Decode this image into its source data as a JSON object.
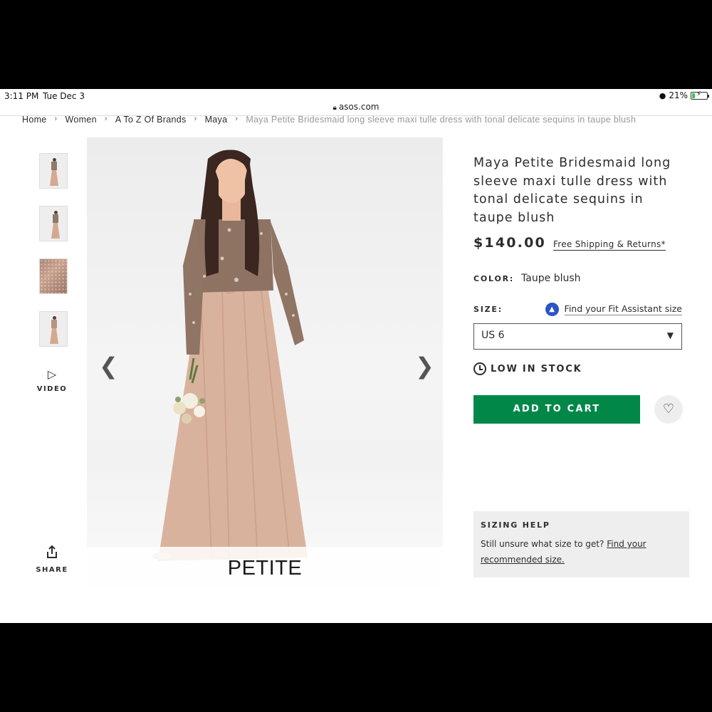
{
  "status_bar": {
    "time": "3:11 PM",
    "date": "Tue Dec 3",
    "battery": "21%",
    "battery_level": 0.21
  },
  "browser": {
    "url": "asos.com"
  },
  "breadcrumb": [
    {
      "label": "Home"
    },
    {
      "label": "Women"
    },
    {
      "label": "A To Z Of Brands"
    },
    {
      "label": "Maya"
    },
    {
      "label": "Maya Petite Bridesmaid long sleeve maxi tulle dress with tonal delicate sequins in taupe blush"
    }
  ],
  "gallery": {
    "video_label": "VIDEO",
    "share_label": "SHARE",
    "image_badge": "PETITE",
    "prev_icon": "chevron-left-icon",
    "next_icon": "chevron-right-icon"
  },
  "product": {
    "title": "Maya Petite Bridesmaid long sleeve maxi tulle dress with tonal delicate sequins in taupe blush",
    "price": "$140.00",
    "shipping_link": "Free Shipping & Returns*",
    "color_label": "COLOR:",
    "color_value": "Taupe blush",
    "size_label": "SIZE:",
    "fit_assistant_link": "Find your Fit Assistant size",
    "size_selected": "US 6",
    "stock_status": "LOW IN STOCK",
    "add_to_cart": "ADD TO CART"
  },
  "sizing_help": {
    "heading": "SIZING HELP",
    "text": "Still unsure what size to get?",
    "link": "Find your recommended size."
  },
  "colors": {
    "cta_green": "#018849",
    "fit_icon_blue": "#2a55c4",
    "panel_grey": "#eeeeee",
    "dress_taupe": "#d4a990"
  }
}
